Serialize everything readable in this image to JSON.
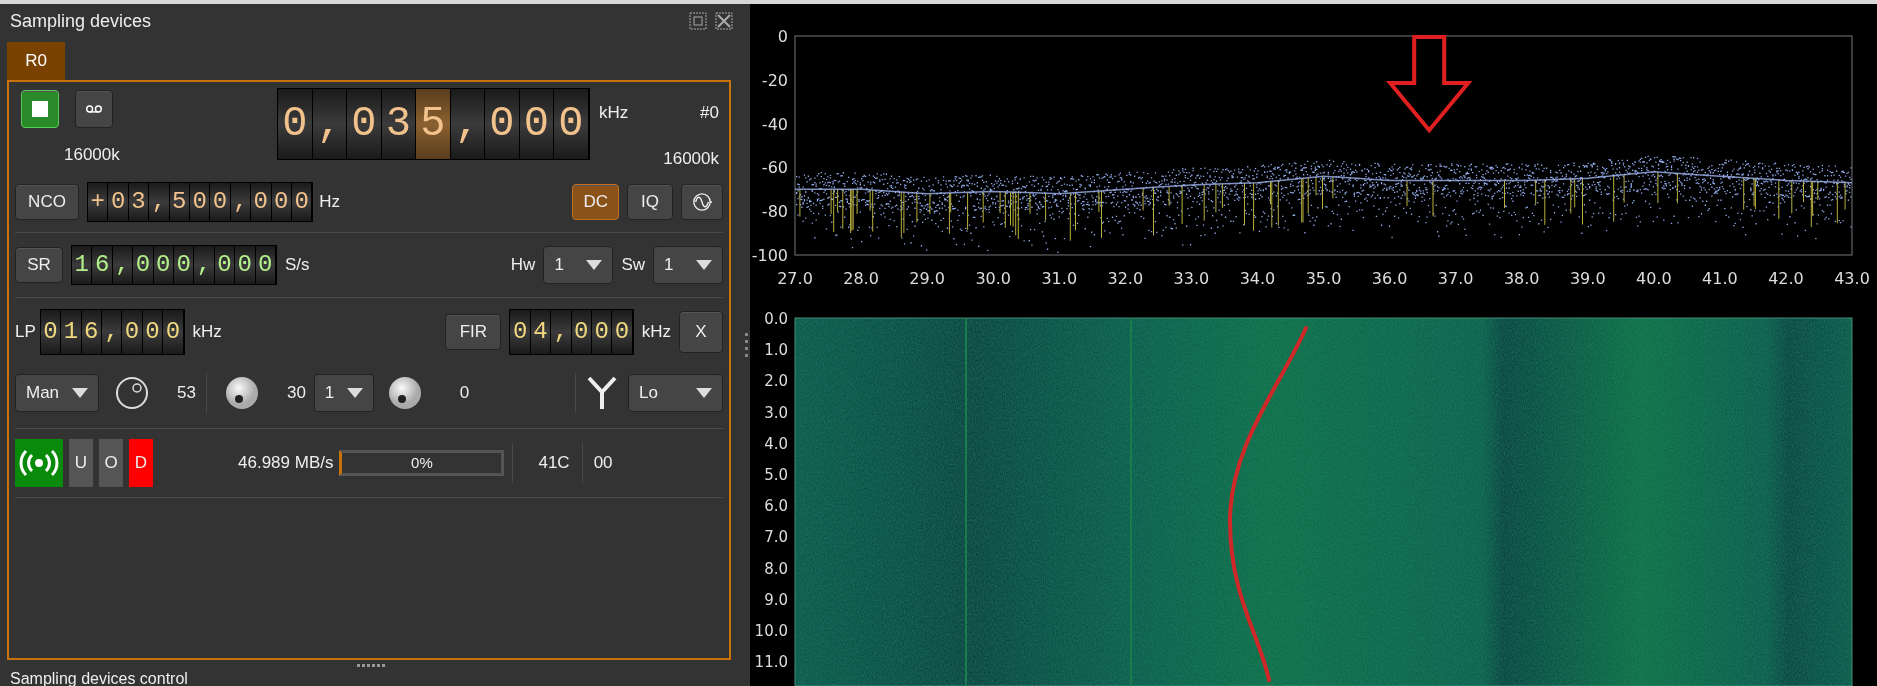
{
  "panel": {
    "title": "Sampling devices",
    "bottom_title": "Sampling devices control"
  },
  "tabs": [
    {
      "label": "R0",
      "selected": true
    }
  ],
  "device": {
    "running": true,
    "recording": false,
    "sample_rate_left": "16000k",
    "frequency": {
      "unit": "kHz",
      "digits": [
        {
          "char": "0",
          "selected": false
        },
        {
          "char": ",",
          "selected": false
        },
        {
          "char": "0",
          "selected": false
        },
        {
          "char": "3",
          "selected": false
        },
        {
          "char": "5",
          "selected": true
        },
        {
          "char": ",",
          "selected": false
        },
        {
          "char": "0",
          "selected": false
        },
        {
          "char": "0",
          "selected": false
        },
        {
          "char": "0",
          "selected": false
        }
      ]
    },
    "device_index": "#0",
    "sample_rate_right": "16000k",
    "nco": {
      "label": "NCO",
      "value": "+03,500,000",
      "unit": "Hz"
    },
    "toggles": [
      {
        "kind": "text",
        "label": "DC",
        "on": true
      },
      {
        "kind": "text",
        "label": "IQ",
        "on": false
      },
      {
        "kind": "icon",
        "on": false
      }
    ],
    "sr": {
      "label": "SR",
      "value": "16,000,000",
      "unit": "S/s"
    },
    "hw": {
      "label": "Hw",
      "value": "1"
    },
    "sw": {
      "label": "Sw",
      "value": "1"
    },
    "lp": {
      "label": "LP",
      "value": "016,000",
      "unit": "kHz"
    },
    "fir": {
      "label": "FIR",
      "value": "04,000",
      "unit": "kHz",
      "clear": "X"
    },
    "gain": {
      "mode": "Man",
      "dial_reading": "53",
      "knob1_reading": "30",
      "select": "1",
      "knob2_reading": "0",
      "antenna": "Lo"
    },
    "status": {
      "streaming": true,
      "flags": [
        {
          "label": "U",
          "on": false
        },
        {
          "label": "O",
          "on": false
        },
        {
          "label": "D",
          "on": true
        }
      ],
      "rate": "46.989 MB/s",
      "buffer": {
        "level": 0,
        "reading": "0%"
      },
      "temperature": "41C",
      "state": "00"
    }
  },
  "spectrum": {
    "y_labels": [
      "0",
      "-20",
      "-40",
      "-60",
      "-80",
      "-100"
    ],
    "x_labels": [
      "27.0",
      "28.0",
      "29.0",
      "30.0",
      "31.0",
      "32.0",
      "33.0",
      "34.0",
      "35.0",
      "36.0",
      "37.0",
      "38.0",
      "39.0",
      "40.0",
      "41.0",
      "42.0",
      "43.0"
    ]
  },
  "waterfall": {
    "y_labels": [
      "0.0",
      "1.0",
      "2.0",
      "3.0",
      "4.0",
      "5.0",
      "6.0",
      "7.0",
      "8.0",
      "9.0",
      "10.0",
      "11.0"
    ]
  }
}
